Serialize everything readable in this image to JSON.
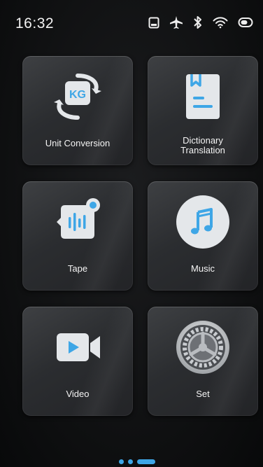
{
  "status_bar": {
    "time": "16:32",
    "icons": [
      "sd-card-icon",
      "airplane-icon",
      "bluetooth-icon",
      "wifi-icon",
      "battery-icon"
    ]
  },
  "apps": [
    {
      "id": "unit",
      "label": "Unit Conversion",
      "icon": "kg-conversion-icon",
      "badge_text": "KG"
    },
    {
      "id": "dict",
      "label_lines": [
        "Dictionary",
        "Translation"
      ],
      "icon": "book-icon"
    },
    {
      "id": "tape",
      "label": "Tape",
      "icon": "voice-recorder-icon"
    },
    {
      "id": "music",
      "label": "Music",
      "icon": "music-note-icon"
    },
    {
      "id": "video",
      "label": "Video",
      "icon": "video-camera-icon"
    },
    {
      "id": "set",
      "label": "Set",
      "icon": "settings-gear-icon"
    }
  ],
  "pager": {
    "pages": 3,
    "current": 3
  },
  "colors": {
    "accent": "#3ea6e6",
    "icon_body": "#e4e7ea",
    "tile_bg": "#2d2f32",
    "background": "#0e0f10"
  }
}
